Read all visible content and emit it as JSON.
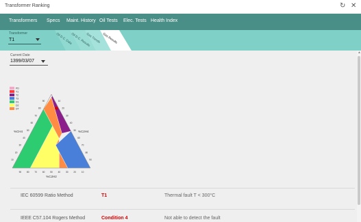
{
  "window": {
    "title": "Transformer Ranking",
    "refresh_icon": "refresh-icon",
    "close_icon": "close-icon"
  },
  "nav": {
    "items": [
      "Transformers",
      "Specs",
      "Maint. History",
      "Oil Tests",
      "Elec. Tests",
      "Health Index"
    ]
  },
  "toolbar": {
    "transformer_label": "Transformer",
    "transformer_value": "T1",
    "tabs": [
      "Oil D.C. Data",
      "Oil D.C. Results",
      "Gas Trends",
      "Gas Results"
    ],
    "active_tab": "Gas Results"
  },
  "current_date": {
    "label": "Current Date",
    "value": "1399/03/07"
  },
  "duval": {
    "legend": [
      "PD",
      "T1",
      "T2",
      "T3",
      "D1",
      "D2",
      "DT"
    ],
    "zones": {
      "D1": "#2ecc71",
      "D2": "#ffff66",
      "DT": "#ff8c42",
      "T3": "#4a7fd9",
      "T2": "#8b1e8b",
      "T1": "#ff3b3b",
      "PD": "#f7a8c8"
    },
    "axis_left": "%CH4",
    "axis_right": "%C2H4",
    "axis_bottom": "%C2H2",
    "ticks": [
      "10",
      "20",
      "30",
      "40",
      "50",
      "60",
      "70",
      "80",
      "90"
    ],
    "point": {
      "ch4": 81,
      "c2h4": 16,
      "c2h2": 3
    }
  },
  "results": [
    {
      "method": "IEC 60599 Ratio Method",
      "result": "T1",
      "description": "Thermal fault T < 300°C"
    },
    {
      "method": "IEEE C57.104 Rogers Method",
      "result": "Condition 4",
      "description": "Not able to detect the fault"
    }
  ]
}
